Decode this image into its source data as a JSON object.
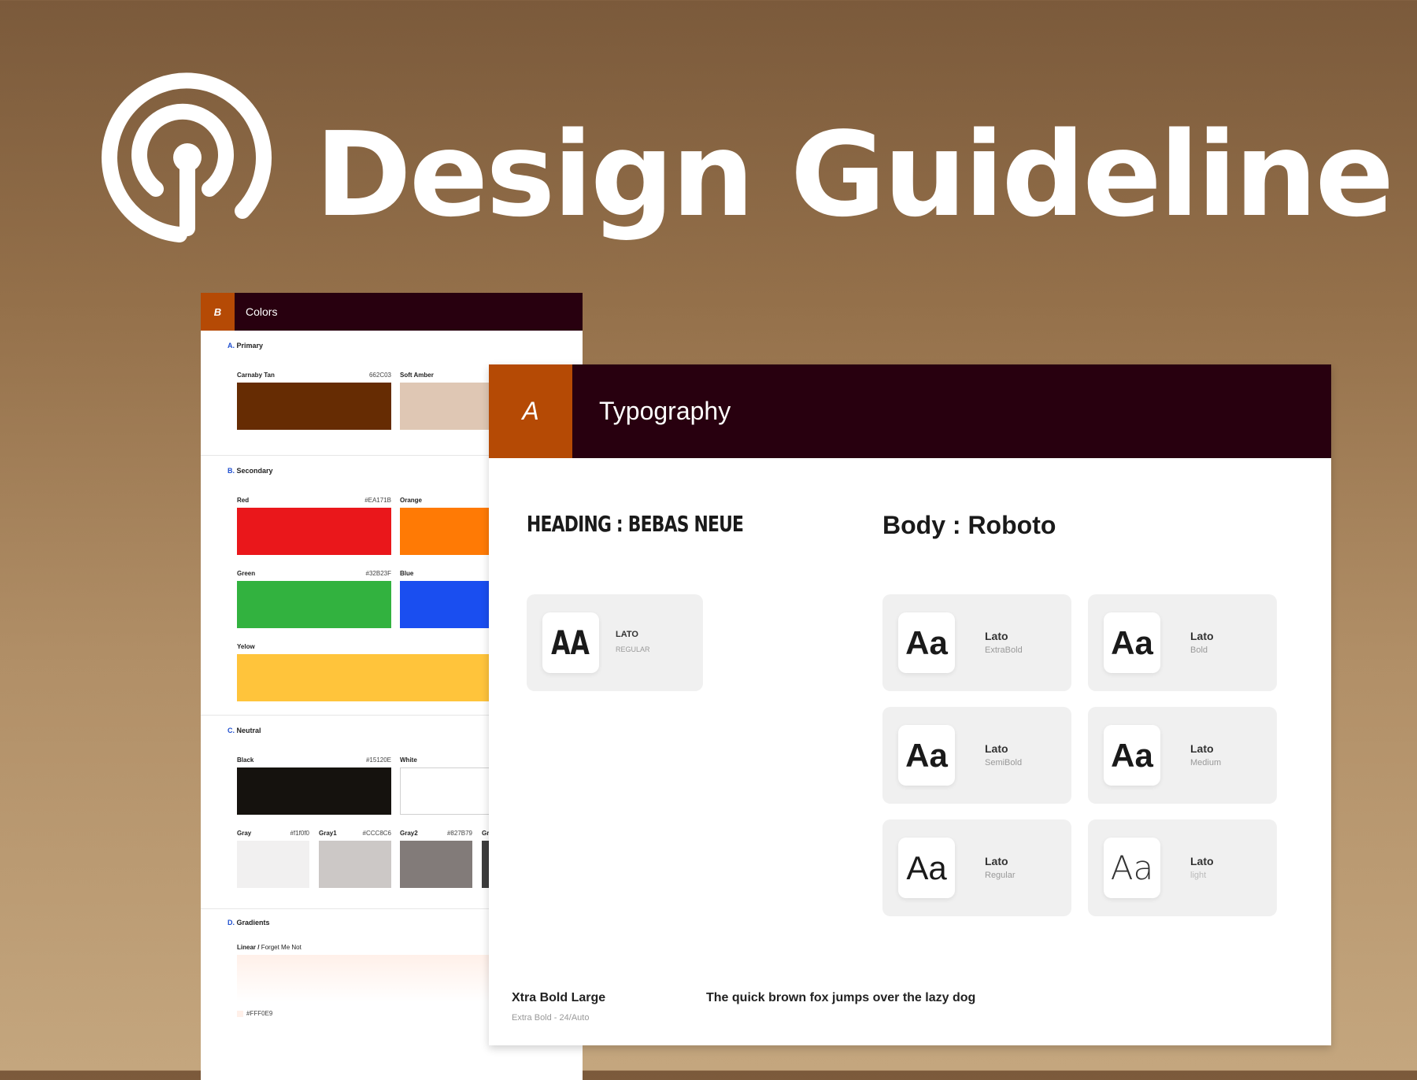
{
  "hero": {
    "title": "Design Guideline",
    "logo_icon": "podcast-signal-icon"
  },
  "colors_card": {
    "letter": "B",
    "title": "Colors",
    "sections": {
      "primary": {
        "letter": "A.",
        "label": "Primary",
        "swatches": [
          {
            "name": "Carnaby Tan",
            "hex": "662C03",
            "color": "#662c03"
          },
          {
            "name": "Soft Amber",
            "hex": "",
            "color": "#dfc7b4"
          }
        ]
      },
      "secondary": {
        "letter": "B.",
        "label": "Secondary",
        "swatches": [
          {
            "name": "Red",
            "hex": "#EA171B",
            "color": "#ea171b"
          },
          {
            "name": "Orange",
            "hex": "",
            "color": "#ff7a05"
          },
          {
            "name": "Green",
            "hex": "#32B23F",
            "color": "#32b23f"
          },
          {
            "name": "Blue",
            "hex": "",
            "color": "#1a4ef0"
          },
          {
            "name": "Yelow",
            "hex": "",
            "color": "#ffc43b"
          }
        ]
      },
      "neutral": {
        "letter": "C.",
        "label": "Neutral",
        "swatches": [
          {
            "name": "Black",
            "hex": "#15120E",
            "color": "#15120e"
          },
          {
            "name": "White",
            "hex": "",
            "color": "#ffffff"
          },
          {
            "name": "Gray",
            "hex": "#f1f0f0",
            "color": "#f1f0f0"
          },
          {
            "name": "Gray1",
            "hex": "#CCC8C6",
            "color": "#ccc8c6"
          },
          {
            "name": "Gray2",
            "hex": "#827B79",
            "color": "#827b79"
          },
          {
            "name": "Gr",
            "hex": "",
            "color": "#3d3d3d"
          }
        ]
      },
      "gradients": {
        "letter": "D.",
        "label": "Gradients",
        "linear_label": "Linear /",
        "linear_name": "Forget Me Not",
        "hex": "#FFF0E9",
        "color": "#fff0e9"
      }
    }
  },
  "typography_card": {
    "letter": "A",
    "title": "Typography",
    "heading_font": "HEADING : BEBAS NEUE",
    "body_font": "Body : Roboto",
    "heading_sample": {
      "glyph": "AA",
      "name": "LATO",
      "weight": "REGULAR"
    },
    "body_samples": [
      {
        "glyph": "Aa",
        "name": "Lato",
        "weight": "ExtraBold"
      },
      {
        "glyph": "Aa",
        "name": "Lato",
        "weight": "Bold"
      },
      {
        "glyph": "Aa",
        "name": "Lato",
        "weight": "SemiBold"
      },
      {
        "glyph": "Aa",
        "name": "Lato",
        "weight": "Medium"
      },
      {
        "glyph": "Aa",
        "name": "Lato",
        "weight": "Regular"
      },
      {
        "glyph": "Aa",
        "name": "Lato",
        "weight": "light"
      }
    ],
    "sample_label": "Xtra Bold Large",
    "sample_spec": "Extra Bold - 24/Auto",
    "sample_text": "The quick brown fox jumps over the lazy dog"
  }
}
